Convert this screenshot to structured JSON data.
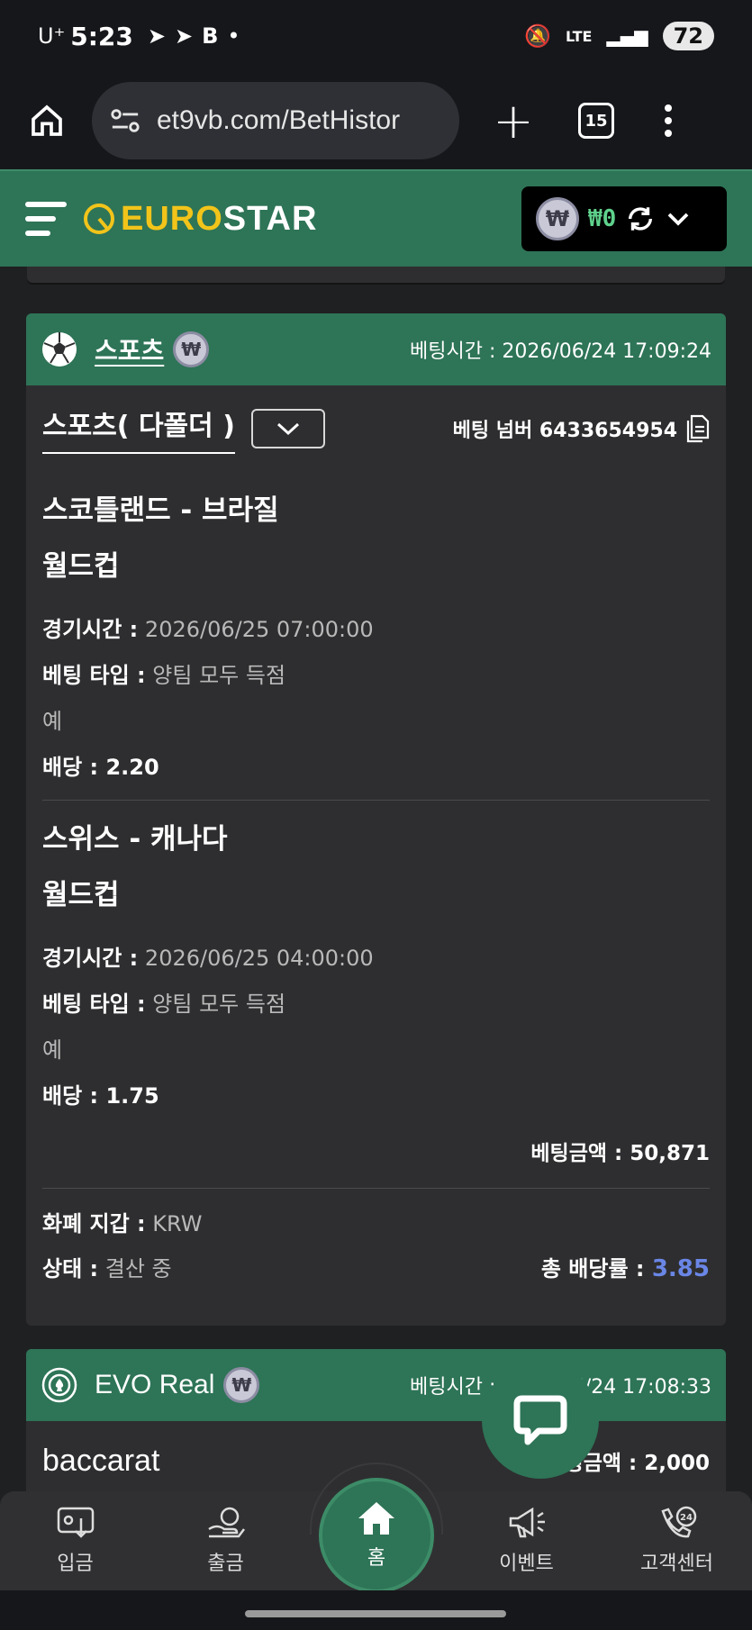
{
  "status_bar": {
    "carrier": "U⁺",
    "time": "5:23",
    "network": "LTE",
    "battery": "72"
  },
  "browser": {
    "url": "et9vb.com/BetHistor",
    "tabs_count": "15"
  },
  "header": {
    "logo_euro": "EURO",
    "logo_star": "STAR",
    "currency_symbol": "₩",
    "balance": "₩0"
  },
  "card1": {
    "category": "스포츠",
    "currency_symbol": "₩",
    "bet_time": "베팅시간 : 2026/06/24 17:09:24",
    "bet_type_label": "스포츠( 다폴더 )",
    "bet_number": "베팅 넘버 6433654954",
    "matches": [
      {
        "teams": "스코틀랜드 - 브라질",
        "league": "월드컵",
        "time_label": "경기시간 :",
        "time_value": "2026/06/25 07:00:00",
        "type_label": "베팅 타입 :",
        "type_value": "양팀 모두 득점",
        "pick": "예",
        "odds": "배당 : 2.20"
      },
      {
        "teams": "스위스 - 캐나다",
        "league": "월드컵",
        "time_label": "경기시간 :",
        "time_value": "2026/06/25 04:00:00",
        "type_label": "베팅 타입 :",
        "type_value": "양팀 모두 득점",
        "pick": "예",
        "odds": "배당 : 1.75"
      }
    ],
    "stake": "베팅금액 : 50,871",
    "wallet_label": "화폐 지갑 :",
    "wallet_value": "KRW",
    "status_label": "상태 :",
    "status_value": "결산 중",
    "total_odds_label": "총 배당률 :",
    "total_odds_value": "3.85"
  },
  "card2": {
    "category": "EVO Real",
    "currency_symbol": "₩",
    "bet_time": "베팅시간 : 2026/06/24 17:08:33",
    "game": "baccarat",
    "stake": "베팅금액 : 2,000"
  },
  "bottom_nav": {
    "deposit": "입금",
    "withdraw": "출금",
    "home": "홈",
    "events": "이벤트",
    "support": "고객센터"
  },
  "colors": {
    "brand_green": "#2e7457",
    "logo_yellow": "#f2c41a",
    "odds_blue": "#6a86e6",
    "balance_green": "#5fd28c"
  }
}
